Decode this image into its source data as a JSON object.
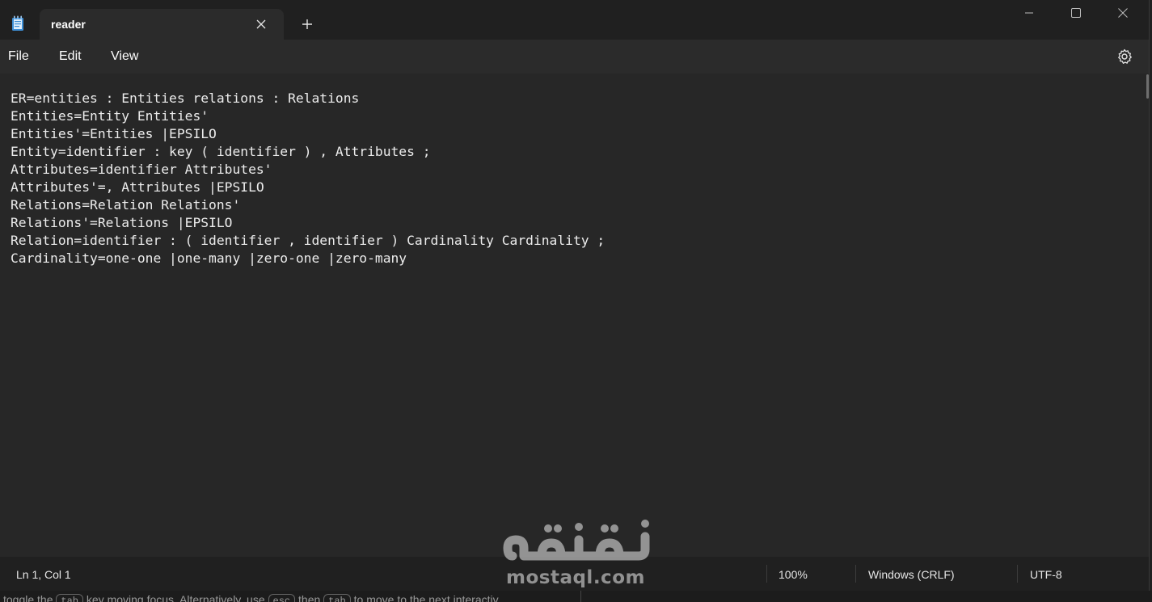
{
  "titlebar": {
    "tab_title": "reader",
    "icons": {
      "app": "notepad-icon",
      "tab_close": "close-icon",
      "new_tab": "plus-icon",
      "minimize": "minimize-icon",
      "maximize": "maximize-icon",
      "close": "close-icon"
    }
  },
  "menu": {
    "file": "File",
    "edit": "Edit",
    "view": "View",
    "settings_icon": "gear-icon"
  },
  "editor": {
    "lines": [
      "ER=entities : Entities relations : Relations",
      "Entities=Entity Entities'",
      "Entities'=Entities |EPSILO",
      "Entity=identifier : key ( identifier ) , Attributes ;",
      "Attributes=identifier Attributes'",
      "Attributes'=, Attributes |EPSILO",
      "Relations=Relation Relations'",
      "Relations'=Relations |EPSILO",
      "Relation=identifier : ( identifier , identifier ) Cardinality Cardinality ;",
      "Cardinality=one-one |one-many |zero-one |zero-many"
    ]
  },
  "status": {
    "position": "Ln 1, Col 1",
    "zoom": "100%",
    "line_ending": "Windows (CRLF)",
    "encoding": "UTF-8"
  },
  "background_hint": {
    "part1": "toggle the",
    "key1": "tab",
    "part2": "key moving focus. Alternatively, use",
    "key2": "esc",
    "part3": "then",
    "key3": "tab",
    "part4": "to move to the next interactiv"
  },
  "watermark": {
    "arabic": "مستقل",
    "latin": "mostaql.com"
  },
  "colors": {
    "titlebar": "#202020",
    "editor": "#272727",
    "text": "#ececec"
  }
}
